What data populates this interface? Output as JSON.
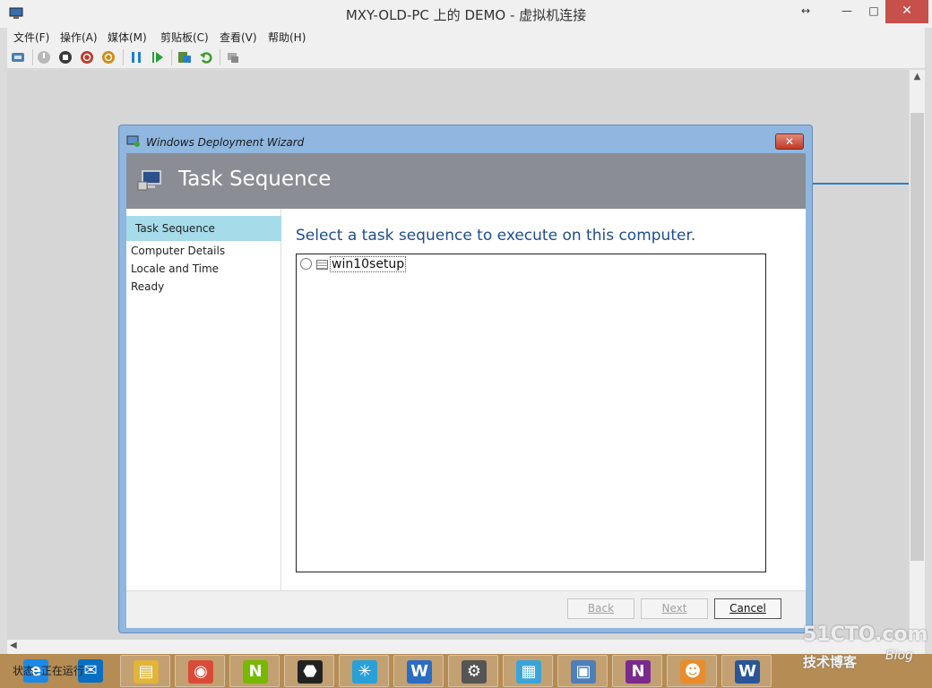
{
  "window": {
    "title": "MXY-OLD-PC 上的 DEMO - 虚拟机连接",
    "resize_glyph": "↔",
    "minimize_glyph": "—",
    "maximize_glyph": "□",
    "close_glyph": "✕"
  },
  "menu": [
    {
      "label": "文件(F)"
    },
    {
      "label": "操作(A)"
    },
    {
      "label": "媒体(M)"
    },
    {
      "label": "剪贴板(C)"
    },
    {
      "label": "查看(V)"
    },
    {
      "label": "帮助(H)"
    }
  ],
  "toolbar": {
    "icons": [
      "ctrl-alt-del-icon",
      "start-icon",
      "turn-off-icon",
      "shutdown-icon",
      "save-icon",
      "pause-icon",
      "reset-icon",
      "checkpoint-icon",
      "revert-icon",
      "enhanced-session-icon"
    ]
  },
  "wizard": {
    "window_title": "Windows Deployment Wizard",
    "close_glyph": "✕",
    "header_title": "Task Sequence",
    "nav": [
      {
        "label": "Task Sequence",
        "active": true
      },
      {
        "label": "Computer Details",
        "active": false
      },
      {
        "label": "Locale and Time",
        "active": false
      },
      {
        "label": "Ready",
        "active": false
      }
    ],
    "prompt": "Select a task sequence to execute on this computer.",
    "task_sequences": [
      {
        "label": "win10setup",
        "selected": false
      }
    ],
    "buttons": {
      "back": "Back",
      "next": "Next",
      "cancel": "Cancel"
    }
  },
  "statusbar": {
    "text": "状态: 正在运行"
  },
  "watermark": {
    "site": "51CTO.com",
    "tagline": "技术博客",
    "blog": "Blog"
  },
  "taskbar": {
    "apps": [
      {
        "name": "internet-explorer-icon",
        "glyph": "e",
        "color": "#1e88e5"
      },
      {
        "name": "mail-icon",
        "glyph": "✉",
        "color": "#0a6fc2"
      },
      {
        "name": "file-explorer-icon",
        "glyph": "▤",
        "color": "#e3b43a"
      },
      {
        "name": "chrome-icon",
        "glyph": "◉",
        "color": "#d94a38"
      },
      {
        "name": "nvidia-icon",
        "glyph": "N",
        "color": "#76b900"
      },
      {
        "name": "android-icon",
        "glyph": "⬣",
        "color": "#222222"
      },
      {
        "name": "app-compass-icon",
        "glyph": "✳",
        "color": "#2aa0d8"
      },
      {
        "name": "wordpad-icon",
        "glyph": "W",
        "color": "#2b6cc4"
      },
      {
        "name": "settings-icon",
        "glyph": "⚙",
        "color": "#555555"
      },
      {
        "name": "server-manager-icon",
        "glyph": "▦",
        "color": "#3aa4d8"
      },
      {
        "name": "hyperv-icon",
        "glyph": "▣",
        "color": "#4e7fb8"
      },
      {
        "name": "onenote-icon",
        "glyph": "N",
        "color": "#7a2a8c"
      },
      {
        "name": "basket-icon",
        "glyph": "☻",
        "color": "#e88c2c"
      },
      {
        "name": "word-icon",
        "glyph": "W",
        "color": "#2a5699"
      }
    ]
  }
}
